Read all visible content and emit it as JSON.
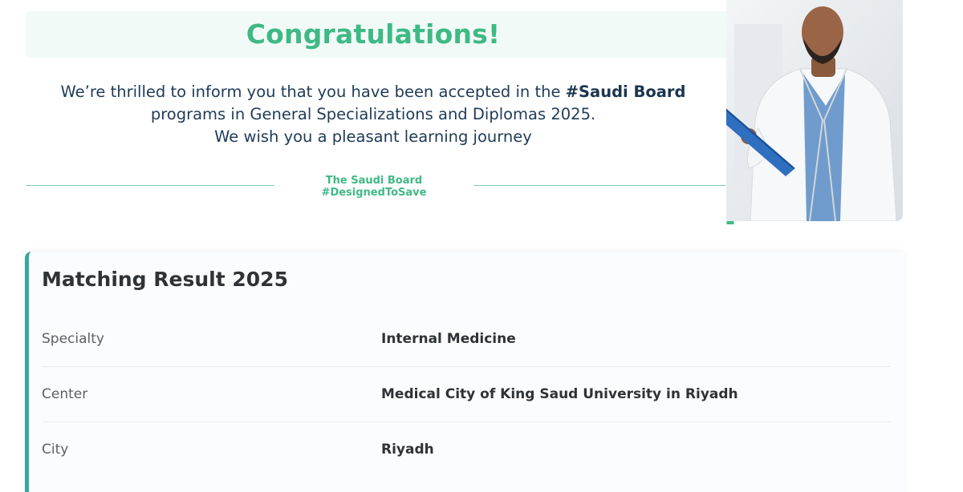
{
  "header": {
    "title": "Congratulations!",
    "message_part1": "We’re thrilled to inform you that you have been accepted in the ",
    "message_highlight": "#Saudi Board",
    "message_line2": "programs in General Specializations and Diplomas 2025.",
    "message_line3": "We wish you a pleasant learning journey",
    "tagline": "The Saudi Board #DesignedToSave"
  },
  "colors": {
    "accent_green": "#3fb985",
    "panel_border_teal": "#3aa6a1",
    "heading_text": "#2e3338",
    "message_text": "#1f3b57"
  },
  "image": {
    "icon": "doctor-photo"
  },
  "result": {
    "title": "Matching Result 2025",
    "rows": [
      {
        "label": "Specialty",
        "value": "Internal Medicine"
      },
      {
        "label": "Center",
        "value": "Medical City of King Saud University in Riyadh"
      },
      {
        "label": "City",
        "value": "Riyadh"
      }
    ]
  }
}
